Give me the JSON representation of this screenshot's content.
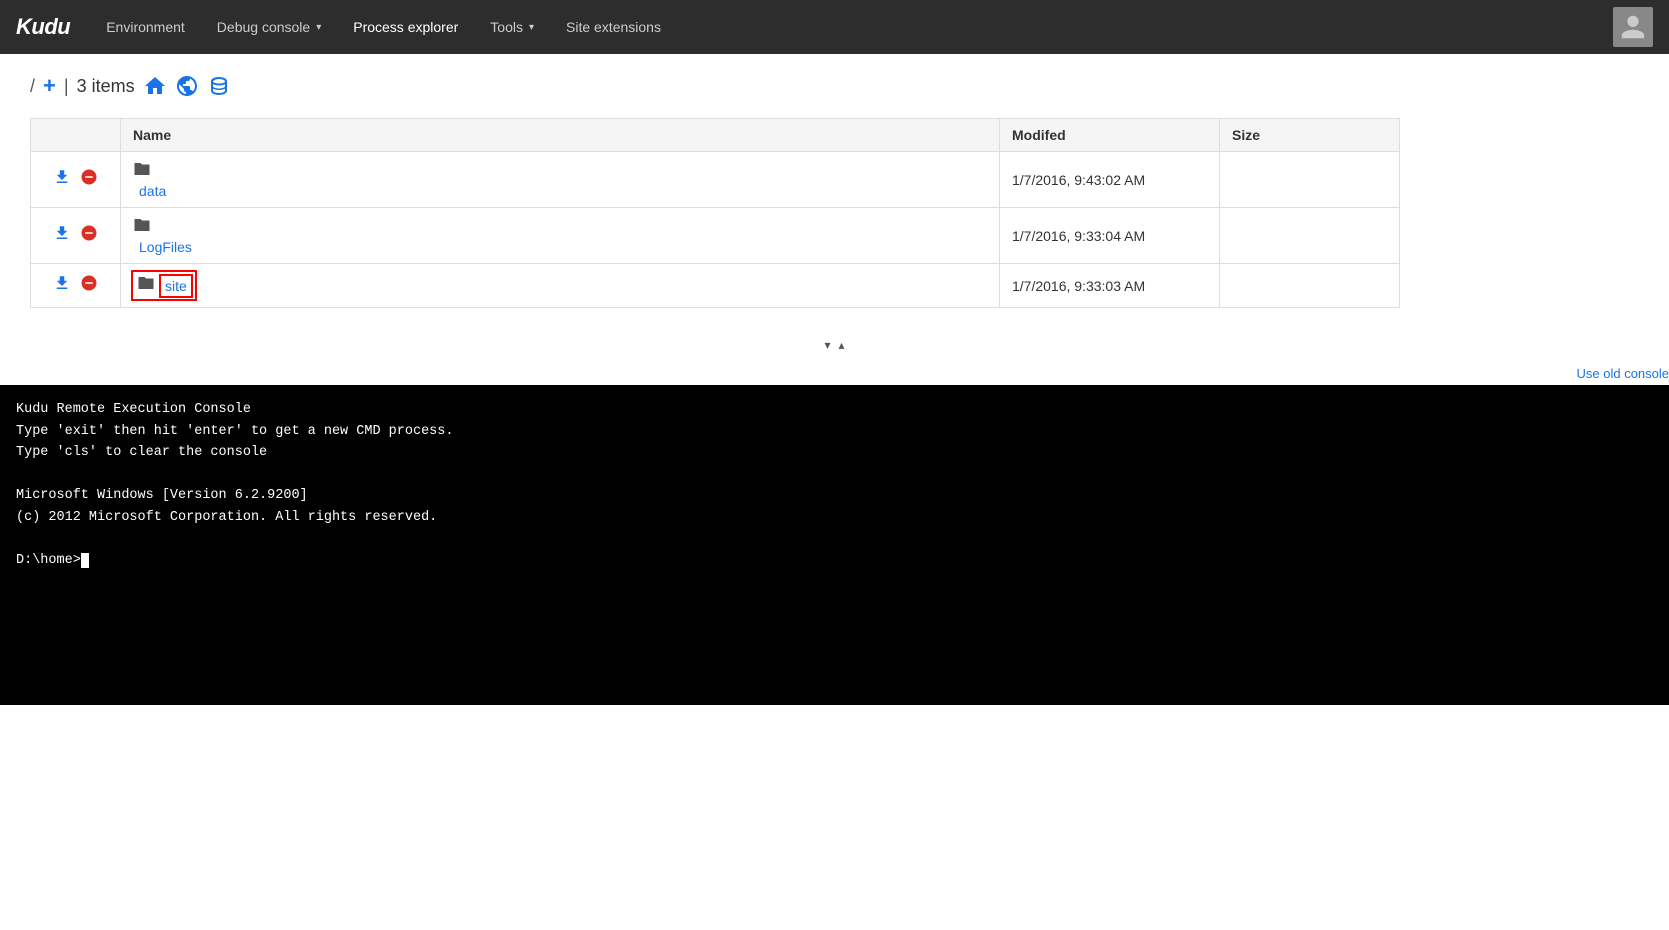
{
  "brand": "Kudu",
  "navbar": {
    "items": [
      {
        "label": "Environment",
        "hasDropdown": false
      },
      {
        "label": "Debug console",
        "hasDropdown": true
      },
      {
        "label": "Process explorer",
        "hasDropdown": false,
        "active": true
      },
      {
        "label": "Tools",
        "hasDropdown": true
      },
      {
        "label": "Site extensions",
        "hasDropdown": false
      }
    ]
  },
  "toolbar": {
    "path": "/",
    "add_label": "+",
    "separator": "|",
    "item_count": "3 items",
    "icons": [
      "home",
      "globe",
      "database"
    ]
  },
  "table": {
    "columns": [
      "",
      "Name",
      "Modifed",
      "Size"
    ],
    "rows": [
      {
        "name": "data",
        "modified": "1/7/2016, 9:43:02 AM",
        "size": "",
        "selected": false
      },
      {
        "name": "LogFiles",
        "modified": "1/7/2016, 9:33:04 AM",
        "size": "",
        "selected": false
      },
      {
        "name": "site",
        "modified": "1/7/2016, 9:33:03 AM",
        "size": "",
        "selected": true
      }
    ]
  },
  "console": {
    "use_old_label": "Use old console",
    "lines": [
      "Kudu Remote Execution Console",
      "Type 'exit' then hit 'enter' to get a new CMD process.",
      "Type 'cls' to clear the console",
      "",
      "Microsoft Windows [Version 6.2.9200]",
      "(c) 2012 Microsoft Corporation. All rights reserved.",
      ""
    ],
    "prompt": "D:\\home>"
  }
}
